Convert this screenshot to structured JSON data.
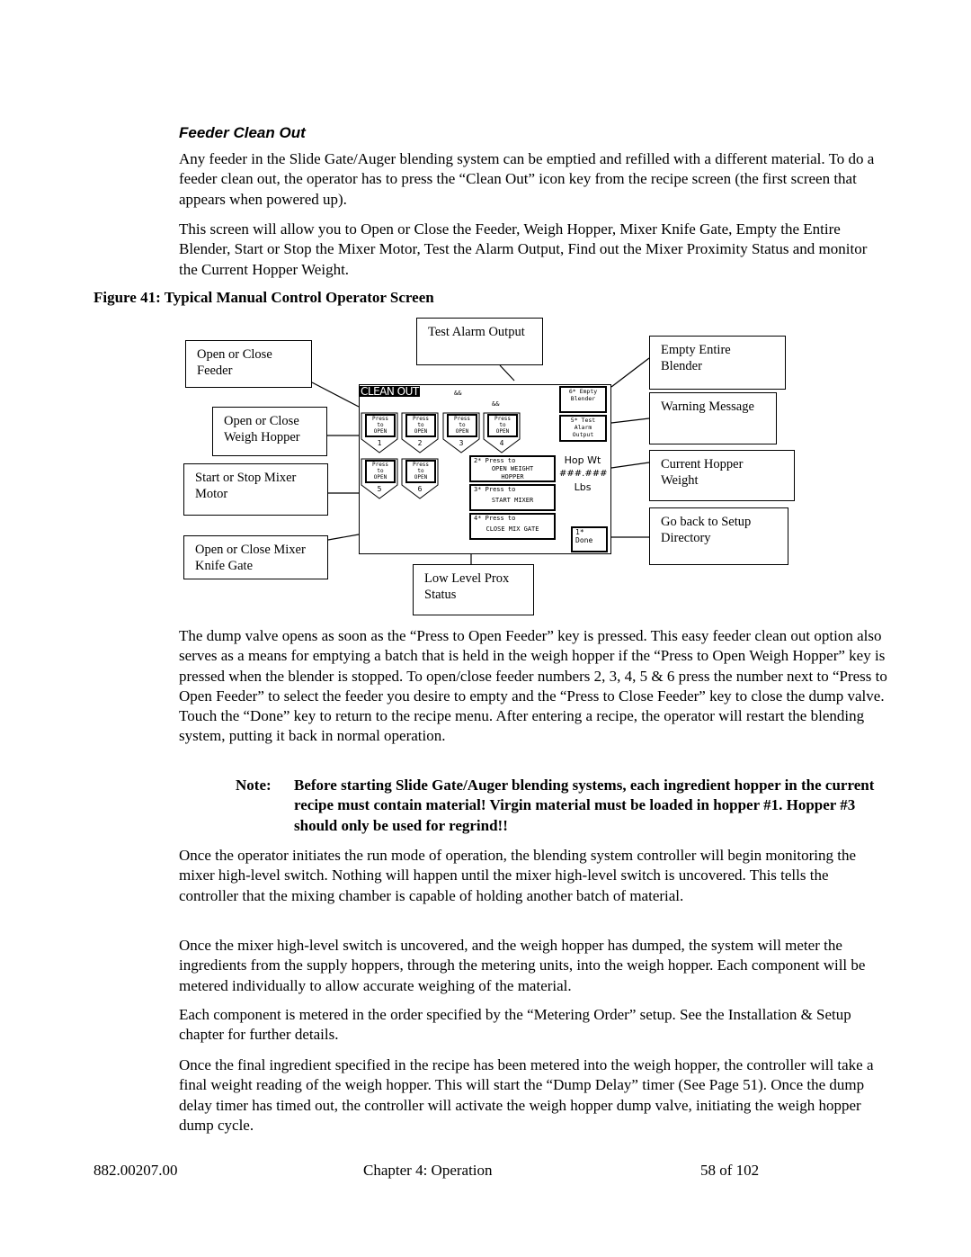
{
  "heading": "Feeder Clean Out",
  "paragraphs": [
    "Any feeder in the Slide Gate/Auger blending system can be emptied and refilled with a different material. To do a feeder clean out, the operator has to press the “Clean Out” icon key from the recipe screen (the first screen that appears when powered up).",
    "This screen will allow you to Open or Close the Feeder, Weigh Hopper, Mixer Knife Gate, Empty the Entire Blender, Start or Stop the Mixer Motor, Test the Alarm Output, Find out the Mixer Proximity Status and monitor the Current Hopper Weight.",
    "The dump valve opens as soon as the “Press to Open Feeder” key is pressed. This easy feeder clean out option also serves as a means for emptying a batch that is held in the weigh hopper if the “Press to Open Weigh Hopper” key is pressed when the blender is stopped. To open/close feeder numbers 2, 3, 4, 5 & 6 press the number next to “Press to Open Feeder” to select the feeder you desire to empty and the “Press to Close Feeder” key to close the dump valve.  Touch the “Done” key to return to the recipe menu. After entering a recipe, the operator will restart the blending system, putting it back in normal operation.",
    "Once the operator initiates the run mode of operation, the blending system controller will begin monitoring the mixer high-level switch. Nothing will happen until the mixer high-level switch is uncovered. This tells the controller that the mixing chamber is capable of holding another batch of material.",
    "Once the mixer high-level switch is uncovered, and the weigh hopper has dumped, the system will meter the ingredients from the supply hoppers, through the metering units, into the weigh hopper. Each component will be metered individually to allow accurate weighing of the material.",
    "Each component is metered in the order specified by the “Metering Order” setup. See the Installation & Setup chapter for further details.",
    "Once the final ingredient specified in the recipe has been metered into the weigh hopper, the controller will take a final weight reading of the weigh hopper. This will start the “Dump Delay” timer (See Page 51). Once the dump delay timer has timed out, the controller will activate the weigh hopper dump valve, initiating the weigh hopper dump cycle."
  ],
  "figure_caption": "Figure 41: Typical Manual Control Operator Screen",
  "callouts": {
    "test_alarm": "Test Alarm Output",
    "feeder": "Open or Close Feeder",
    "empty": "Empty Entire Blender",
    "weigh_hopper": "Open or Close Weigh Hopper",
    "warning": "Warning Message",
    "mixer_motor": "Start or Stop Mixer Motor",
    "hopper_weight": "Current Hopper Weight",
    "setup": "Go back to Setup Directory",
    "knife_gate": "Open or Close Mixer Knife Gate",
    "prox": "Low Level Prox Status"
  },
  "screen": {
    "title": "CLEAN OUT",
    "marker1": "&&",
    "marker2": "&&",
    "feeder_btn": [
      "Press",
      "to",
      "OPEN"
    ],
    "feeders": [
      "1",
      "2",
      "3",
      "4",
      "5",
      "6"
    ],
    "empty": {
      "l1": "6* Empty",
      "l2": "Blender"
    },
    "test": {
      "l1": "5* Test",
      "l2": "Alarm",
      "l3": "Output"
    },
    "open_weight": {
      "l1": "2* Press to",
      "l2": "OPEN WEIGHT",
      "l3": "HOPPER"
    },
    "start_mixer": {
      "l1": "3* Press to",
      "l2": "START MIXER"
    },
    "close_gate": {
      "l1": "4* Press to",
      "l2": "CLOSE MIX GATE"
    },
    "hop_wt": "Hop Wt",
    "hop_val": "###.###",
    "hop_unit": "Lbs",
    "done": {
      "l1": "1*",
      "l2": "Done"
    }
  },
  "note": {
    "label": "Note:",
    "text": "Before starting Slide Gate/Auger blending systems, each ingredient hopper in the current recipe must contain material!  Virgin material must be loaded in hopper #1.  Hopper #3 should only be used for regrind!!"
  },
  "footer": {
    "left": "882.00207.00",
    "center": "Chapter 4: Operation",
    "right": "58 of 102"
  }
}
